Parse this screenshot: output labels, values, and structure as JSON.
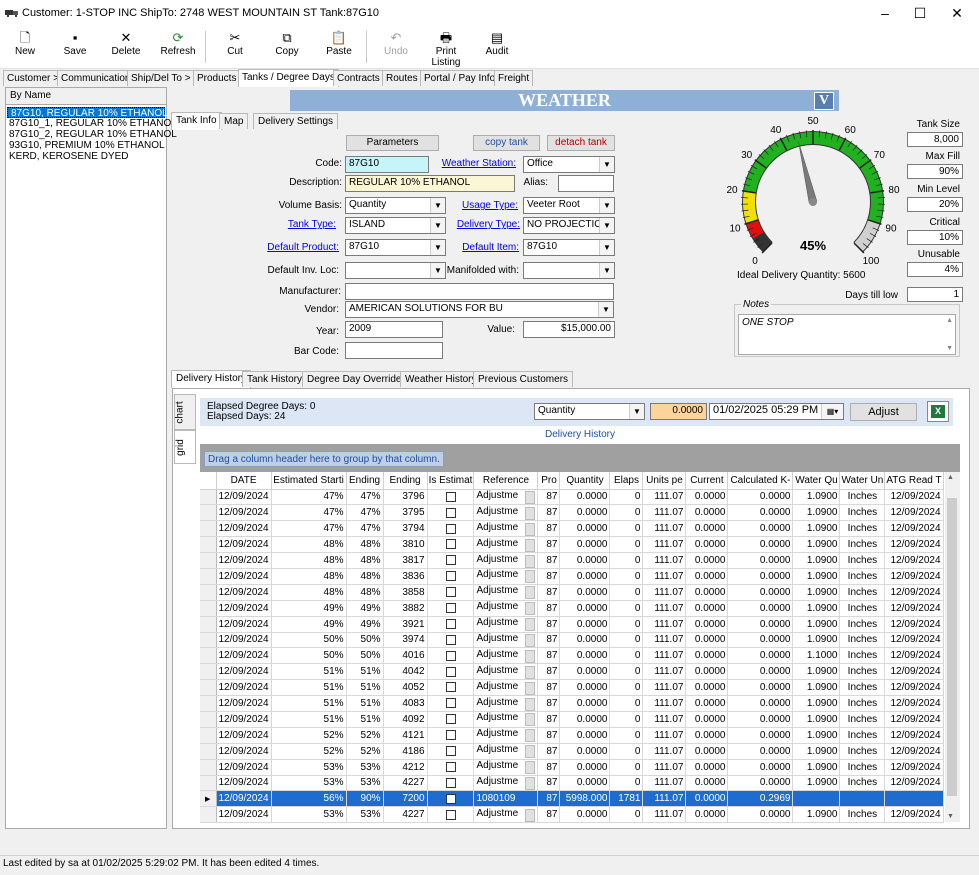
{
  "window": {
    "title": "Customer: 1-STOP INC ShipTo: 2748 WEST MOUNTAIN ST Tank:87G10"
  },
  "toolbar": {
    "new": "New",
    "save": "Save",
    "delete": "Delete",
    "refresh": "Refresh",
    "cut": "Cut",
    "copy": "Copy",
    "paste": "Paste",
    "undo": "Undo",
    "print": "Print Listing",
    "audit": "Audit"
  },
  "tabs": [
    "Customer >",
    "Communication",
    "Ship/Del To >",
    "Products",
    "Tanks / Degree Days",
    "Contracts",
    "Routes",
    "Portal / Pay Info",
    "Freight"
  ],
  "leftpanel": {
    "header": "By Name",
    "items": [
      "87G10, REGULAR 10% ETHANOL",
      "87G10_1, REGULAR 10% ETHANOL",
      "87G10_2, REGULAR 10% ETHANOL",
      "93G10, PREMIUM 10% ETHANOL",
      "KERD, KEROSENE DYED"
    ]
  },
  "weather": {
    "title": "WEATHER",
    "v": "V"
  },
  "subtabs": [
    "Tank Info",
    "Map",
    "Delivery Settings"
  ],
  "form": {
    "parameters": "Parameters",
    "copy_tank": "copy tank",
    "detach_tank": "detach tank",
    "code_label": "Code:",
    "code": "87G10",
    "weather_station_label": "Weather Station:",
    "weather_station": "Office",
    "description_label": "Description:",
    "description": "REGULAR 10% ETHANOL",
    "alias_label": "Alias:",
    "alias": "",
    "volume_basis_label": "Volume Basis:",
    "volume_basis": "Quantity",
    "usage_type_label": "Usage Type:",
    "usage_type": "Veeter Root",
    "tank_type_label": "Tank Type:",
    "tank_type": "ISLAND",
    "delivery_type_label": "Delivery Type:",
    "delivery_type": "NO PROJECTIO",
    "default_product_label": "Default Product:",
    "default_product": "87G10",
    "default_item_label": "Default Item:",
    "default_item": "87G10",
    "default_inv_loc_label": "Default Inv. Loc:",
    "default_inv_loc": "",
    "manifolded_label": "Manifolded with:",
    "manifolded": "",
    "manufacturer_label": "Manufacturer:",
    "manufacturer": "",
    "vendor_label": "Vendor:",
    "vendor": "AMERICAN SOLUTIONS FOR BU",
    "year_label": "Year:",
    "year": "2009",
    "value_label": "Value:",
    "value": "$15,000.00",
    "barcode_label": "Bar Code:",
    "barcode": ""
  },
  "gauge": {
    "percent": "45%",
    "value_fraction": 0.45,
    "ticks": [
      "0",
      "10",
      "20",
      "30",
      "40",
      "50",
      "60",
      "70",
      "80",
      "90",
      "100"
    ],
    "ideal": "Ideal Delivery Quantity: 5600"
  },
  "right": {
    "tank_size_label": "Tank Size",
    "tank_size": "8,000",
    "max_fill_label": "Max Fill",
    "max_fill": "90%",
    "min_level_label": "Min Level",
    "min_level": "20%",
    "critical_label": "Critical",
    "critical": "10%",
    "unusable_label": "Unusable",
    "unusable": "4%",
    "days_low_label": "Days till low",
    "days_low": "1"
  },
  "notes": {
    "legend": "Notes",
    "text": "ONE STOP"
  },
  "lowertabs": [
    "Delivery History",
    "Tank History",
    "Degree Day Overrides",
    "Weather History",
    "Previous Customers"
  ],
  "vtabs": [
    "chart",
    "grid"
  ],
  "gridtop": {
    "elapsed_dd": "Elapsed Degree Days: 0",
    "elapsed_days": "Elapsed Days: 24",
    "qty_select": "Quantity",
    "qty_value": "0.0000",
    "date": "01/02/2025 05:29 PM",
    "adjust": "Adjust"
  },
  "grid_title": "Delivery History",
  "group_hint": "Drag a column header here to group by that column.",
  "columns": [
    "DATE",
    "Estimated Starti",
    "Ending",
    "Ending",
    "Is Estimat",
    "Reference",
    "Pro",
    "Quantity",
    "Elaps",
    "Units pe",
    "Current",
    "Calculated K-",
    "Water Qu",
    "Water Un",
    "ATG Read T"
  ],
  "rows": [
    [
      "12/09/2024",
      "47%",
      "47%",
      "3796",
      "",
      "Adjustme",
      "87",
      "0.0000",
      "0",
      "111.07",
      "0.0000",
      "0.0000",
      "1.0900",
      "Inches",
      "12/09/2024"
    ],
    [
      "12/09/2024",
      "47%",
      "47%",
      "3795",
      "",
      "Adjustme",
      "87",
      "0.0000",
      "0",
      "111.07",
      "0.0000",
      "0.0000",
      "1.0900",
      "Inches",
      "12/09/2024"
    ],
    [
      "12/09/2024",
      "47%",
      "47%",
      "3794",
      "",
      "Adjustme",
      "87",
      "0.0000",
      "0",
      "111.07",
      "0.0000",
      "0.0000",
      "1.0900",
      "Inches",
      "12/09/2024"
    ],
    [
      "12/09/2024",
      "48%",
      "48%",
      "3810",
      "",
      "Adjustme",
      "87",
      "0.0000",
      "0",
      "111.07",
      "0.0000",
      "0.0000",
      "1.0900",
      "Inches",
      "12/09/2024"
    ],
    [
      "12/09/2024",
      "48%",
      "48%",
      "3817",
      "",
      "Adjustme",
      "87",
      "0.0000",
      "0",
      "111.07",
      "0.0000",
      "0.0000",
      "1.0900",
      "Inches",
      "12/09/2024"
    ],
    [
      "12/09/2024",
      "48%",
      "48%",
      "3836",
      "",
      "Adjustme",
      "87",
      "0.0000",
      "0",
      "111.07",
      "0.0000",
      "0.0000",
      "1.0900",
      "Inches",
      "12/09/2024"
    ],
    [
      "12/09/2024",
      "48%",
      "48%",
      "3858",
      "",
      "Adjustme",
      "87",
      "0.0000",
      "0",
      "111.07",
      "0.0000",
      "0.0000",
      "1.0900",
      "Inches",
      "12/09/2024"
    ],
    [
      "12/09/2024",
      "49%",
      "49%",
      "3882",
      "",
      "Adjustme",
      "87",
      "0.0000",
      "0",
      "111.07",
      "0.0000",
      "0.0000",
      "1.0900",
      "Inches",
      "12/09/2024"
    ],
    [
      "12/09/2024",
      "49%",
      "49%",
      "3921",
      "",
      "Adjustme",
      "87",
      "0.0000",
      "0",
      "111.07",
      "0.0000",
      "0.0000",
      "1.0900",
      "Inches",
      "12/09/2024"
    ],
    [
      "12/09/2024",
      "50%",
      "50%",
      "3974",
      "",
      "Adjustme",
      "87",
      "0.0000",
      "0",
      "111.07",
      "0.0000",
      "0.0000",
      "1.0900",
      "Inches",
      "12/09/2024"
    ],
    [
      "12/09/2024",
      "50%",
      "50%",
      "4016",
      "",
      "Adjustme",
      "87",
      "0.0000",
      "0",
      "111.07",
      "0.0000",
      "0.0000",
      "1.1000",
      "Inches",
      "12/09/2024"
    ],
    [
      "12/09/2024",
      "51%",
      "51%",
      "4042",
      "",
      "Adjustme",
      "87",
      "0.0000",
      "0",
      "111.07",
      "0.0000",
      "0.0000",
      "1.0900",
      "Inches",
      "12/09/2024"
    ],
    [
      "12/09/2024",
      "51%",
      "51%",
      "4052",
      "",
      "Adjustme",
      "87",
      "0.0000",
      "0",
      "111.07",
      "0.0000",
      "0.0000",
      "1.0900",
      "Inches",
      "12/09/2024"
    ],
    [
      "12/09/2024",
      "51%",
      "51%",
      "4083",
      "",
      "Adjustme",
      "87",
      "0.0000",
      "0",
      "111.07",
      "0.0000",
      "0.0000",
      "1.0900",
      "Inches",
      "12/09/2024"
    ],
    [
      "12/09/2024",
      "51%",
      "51%",
      "4092",
      "",
      "Adjustme",
      "87",
      "0.0000",
      "0",
      "111.07",
      "0.0000",
      "0.0000",
      "1.0900",
      "Inches",
      "12/09/2024"
    ],
    [
      "12/09/2024",
      "52%",
      "52%",
      "4121",
      "",
      "Adjustme",
      "87",
      "0.0000",
      "0",
      "111.07",
      "0.0000",
      "0.0000",
      "1.0900",
      "Inches",
      "12/09/2024"
    ],
    [
      "12/09/2024",
      "52%",
      "52%",
      "4186",
      "",
      "Adjustme",
      "87",
      "0.0000",
      "0",
      "111.07",
      "0.0000",
      "0.0000",
      "1.0900",
      "Inches",
      "12/09/2024"
    ],
    [
      "12/09/2024",
      "53%",
      "53%",
      "4212",
      "",
      "Adjustme",
      "87",
      "0.0000",
      "0",
      "111.07",
      "0.0000",
      "0.0000",
      "1.0900",
      "Inches",
      "12/09/2024"
    ],
    [
      "12/09/2024",
      "53%",
      "53%",
      "4227",
      "",
      "Adjustme",
      "87",
      "0.0000",
      "0",
      "111.07",
      "0.0000",
      "0.0000",
      "1.0900",
      "Inches",
      "12/09/2024"
    ],
    [
      "12/09/2024",
      "56%",
      "90%",
      "7200",
      "✓",
      "1080109",
      "87",
      "5998.000",
      "1781",
      "111.07",
      "0.0000",
      "0.2969",
      "",
      "",
      ""
    ],
    [
      "12/09/2024",
      "53%",
      "53%",
      "4227",
      "",
      "Adjustme",
      "87",
      "0.0000",
      "0",
      "111.07",
      "0.0000",
      "0.0000",
      "1.0900",
      "Inches",
      "12/09/2024"
    ]
  ],
  "highlight_row": 19,
  "status": "Last edited by sa at 01/02/2025 5:29:02 PM. It has been edited 4 times."
}
